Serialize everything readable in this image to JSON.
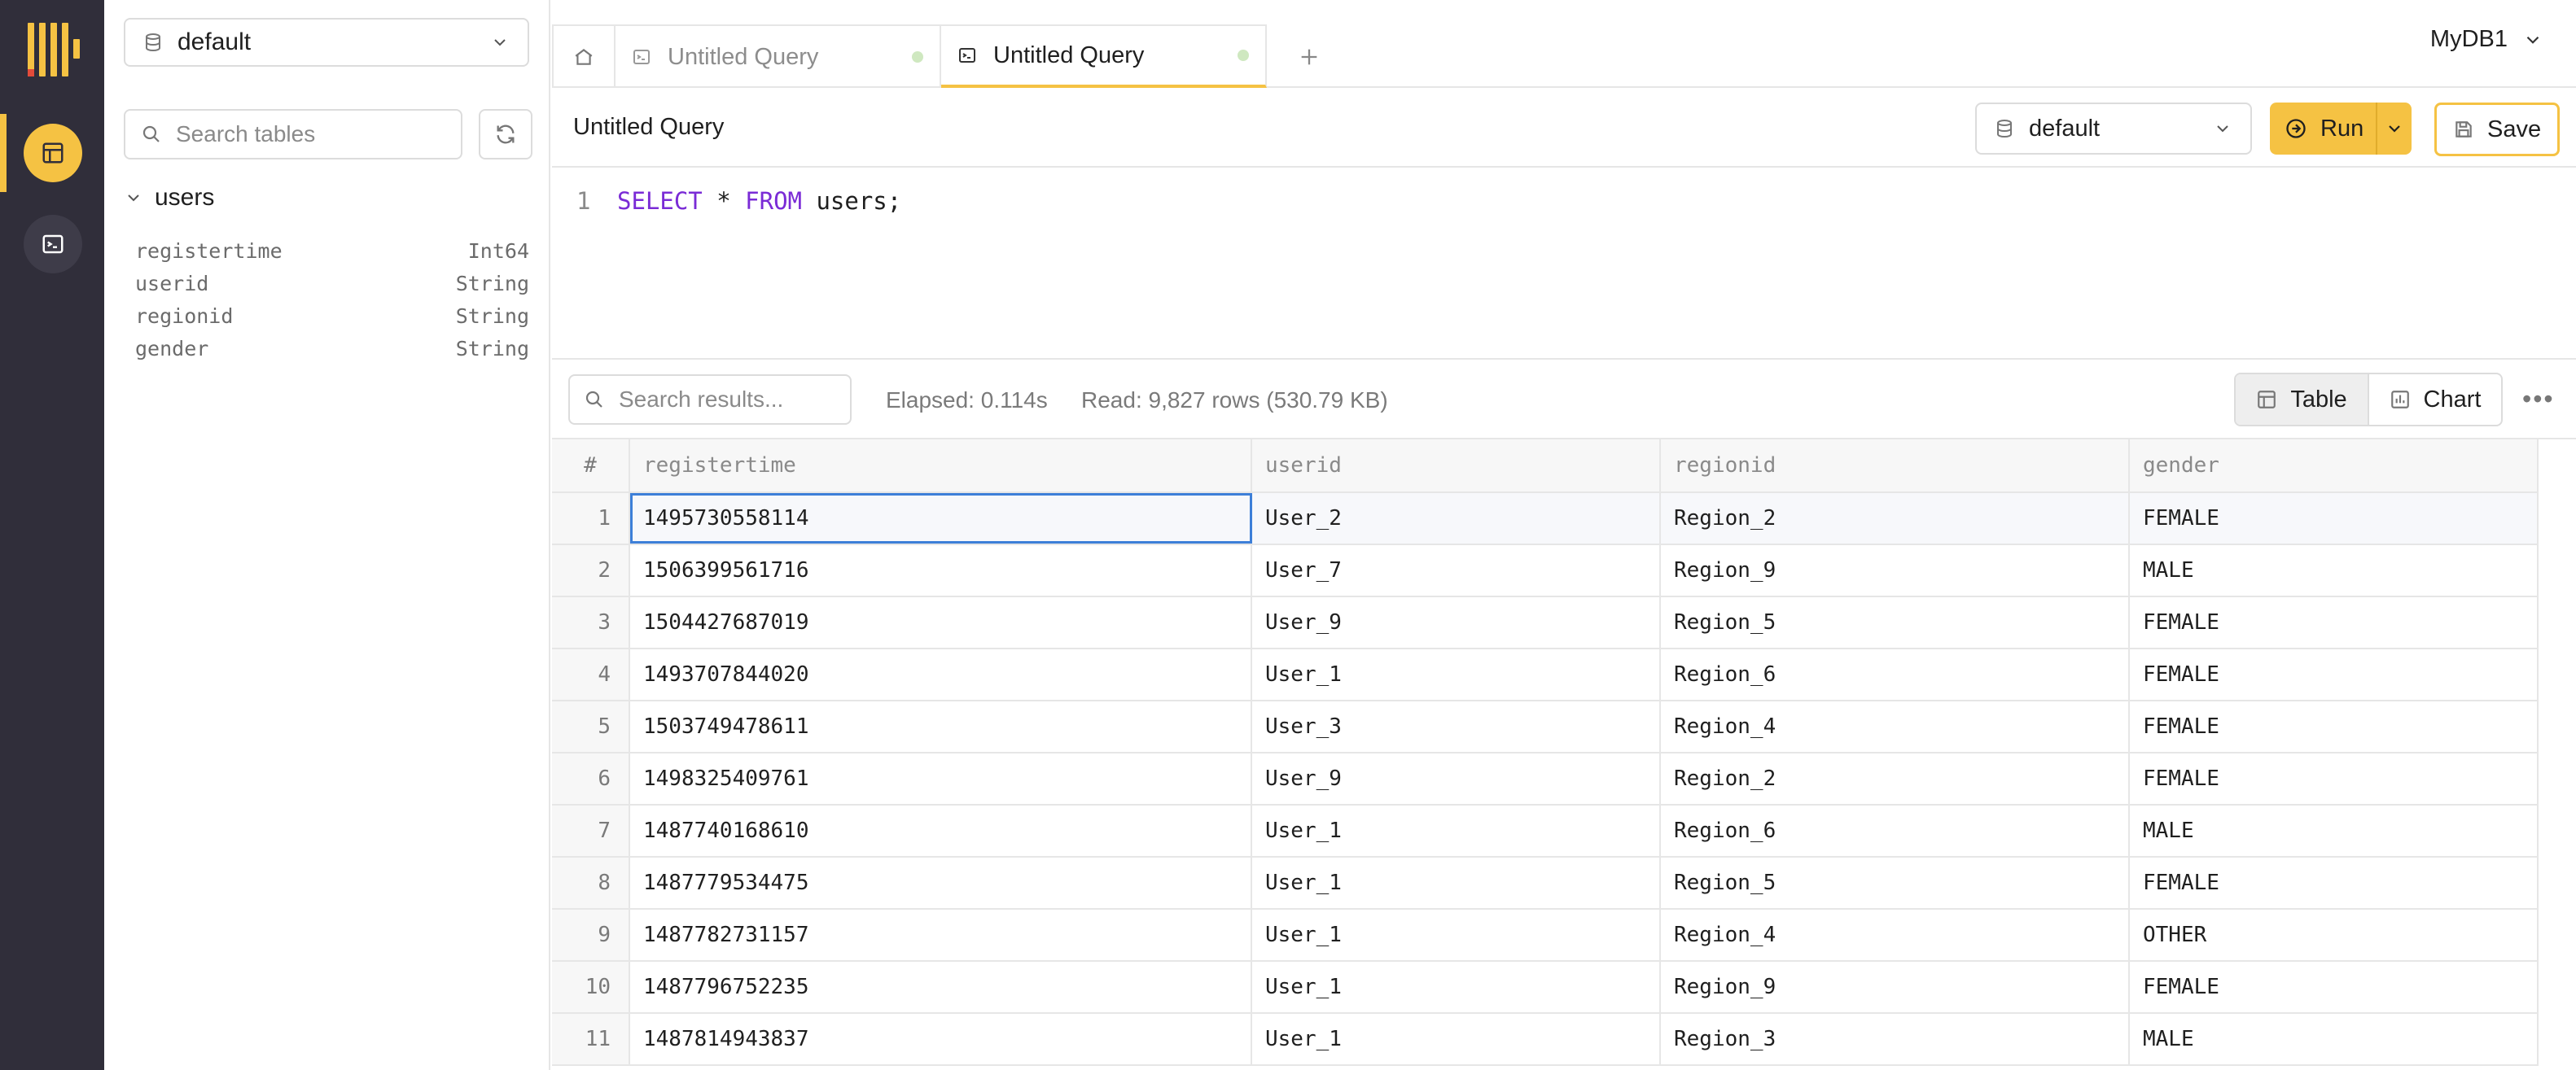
{
  "sidebar": {
    "database": "default",
    "search_placeholder": "Search tables",
    "table_name": "users",
    "columns": [
      {
        "name": "registertime",
        "type": "Int64"
      },
      {
        "name": "userid",
        "type": "String"
      },
      {
        "name": "regionid",
        "type": "String"
      },
      {
        "name": "gender",
        "type": "String"
      }
    ]
  },
  "tabs": [
    {
      "label": "Untitled Query"
    },
    {
      "label": "Untitled Query"
    }
  ],
  "connection": "MyDB1",
  "query": {
    "title": "Untitled Query",
    "database": "default",
    "run_label": "Run",
    "save_label": "Save",
    "line_number": "1",
    "code": {
      "kw1": "SELECT",
      "mid": " * ",
      "kw2": "FROM",
      "rest": " users;"
    }
  },
  "results": {
    "search_placeholder": "Search results...",
    "elapsed": "Elapsed: 0.114s",
    "read": "Read: 9,827 rows (530.79 KB)",
    "view_table": "Table",
    "view_chart": "Chart",
    "headers": [
      "#",
      "registertime",
      "userid",
      "regionid",
      "gender"
    ],
    "rows": [
      [
        "1",
        "1495730558114",
        "User_2",
        "Region_2",
        "FEMALE"
      ],
      [
        "2",
        "1506399561716",
        "User_7",
        "Region_9",
        "MALE"
      ],
      [
        "3",
        "1504427687019",
        "User_9",
        "Region_5",
        "FEMALE"
      ],
      [
        "4",
        "1493707844020",
        "User_1",
        "Region_6",
        "FEMALE"
      ],
      [
        "5",
        "1503749478611",
        "User_3",
        "Region_4",
        "FEMALE"
      ],
      [
        "6",
        "1498325409761",
        "User_9",
        "Region_2",
        "FEMALE"
      ],
      [
        "7",
        "1487740168610",
        "User_1",
        "Region_6",
        "MALE"
      ],
      [
        "8",
        "1487779534475",
        "User_1",
        "Region_5",
        "FEMALE"
      ],
      [
        "9",
        "1487782731157",
        "User_1",
        "Region_4",
        "OTHER"
      ],
      [
        "10",
        "1487796752235",
        "User_1",
        "Region_9",
        "FEMALE"
      ],
      [
        "11",
        "1487814943837",
        "User_1",
        "Region_3",
        "MALE"
      ]
    ]
  },
  "colors": {
    "accent": "#f5c243",
    "rail": "#302e3a",
    "keyword": "#7a2bd6",
    "focus": "#3d7fd8"
  }
}
